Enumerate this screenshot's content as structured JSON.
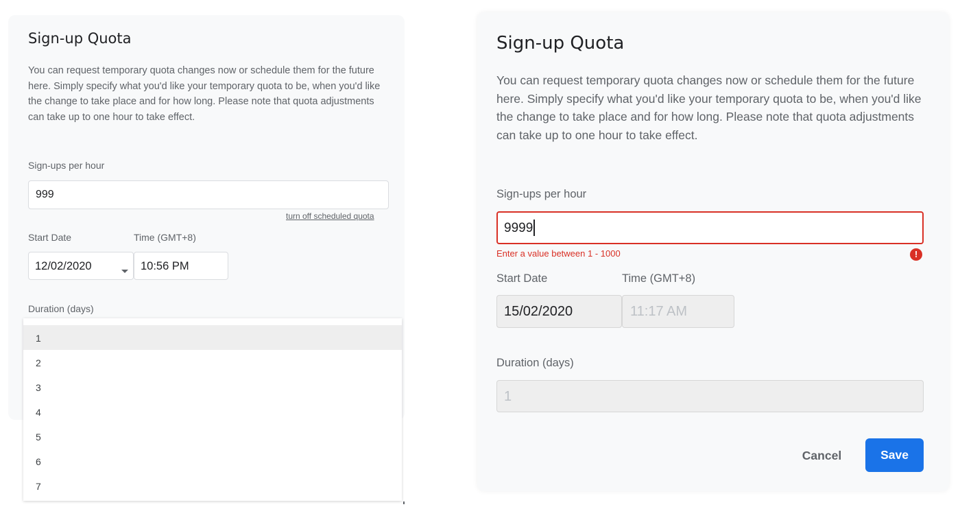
{
  "left": {
    "title": "Sign-up Quota",
    "description": "You can request temporary quota changes now or schedule them for the future here. Simply specify what you'd like your temporary quota to be, when you'd like the change to take place and for how long. Please note that quota adjustments can take up to one hour to take effect.",
    "signups_label": "Sign-ups per hour",
    "signups_value": "999",
    "turn_off_link": "turn off scheduled quota",
    "start_date_label": "Start Date",
    "start_date_value": "12/02/2020",
    "time_label": "Time (GMT+8)",
    "time_value": "10:56 PM",
    "duration_label": "Duration (days)",
    "duration_options": [
      "1",
      "2",
      "3",
      "4",
      "5",
      "6",
      "7"
    ],
    "duration_selected": "1"
  },
  "right": {
    "title": "Sign-up Quota",
    "description": "You can request temporary quota changes now or schedule them for the future here. Simply specify what you'd like your temporary quota to be, when you'd like the change to take place and for how long. Please note that quota adjustments can take up to one hour to take effect.",
    "signups_label": "Sign-ups per hour",
    "signups_value": "9999",
    "error_text": "Enter a value between 1 - 1000",
    "error_icon": "!",
    "start_date_label": "Start Date",
    "start_date_value": "15/02/2020",
    "time_label": "Time (GMT+8)",
    "time_value": "11:17 AM",
    "duration_label": "Duration (days)",
    "duration_value": "1",
    "cancel_label": "Cancel",
    "save_label": "Save"
  },
  "colors": {
    "error": "#d93025",
    "primary": "#1a73e8",
    "panel_bg": "#f8f9fa",
    "disabled_bg": "#eeeeee"
  }
}
